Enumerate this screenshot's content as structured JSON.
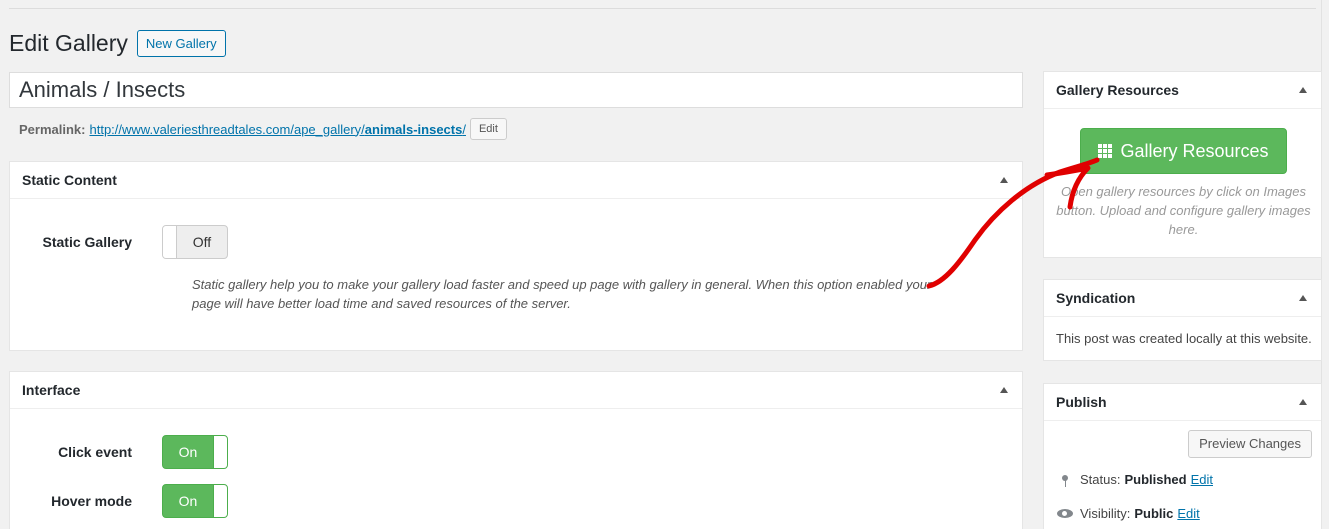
{
  "header": {
    "title": "Edit Gallery",
    "new_button": "New Gallery"
  },
  "post": {
    "title": "Animals / Insects",
    "permalink_label": "Permalink:",
    "permalink_base": "http://www.valeriesthreadtales.com/ape_gallery/",
    "permalink_slug": "animals-insects",
    "permalink_tail": "/",
    "permalink_edit": "Edit"
  },
  "static_content": {
    "heading": "Static Content",
    "option_label": "Static Gallery",
    "switch_value": "Off",
    "description": "Static gallery help you to make your gallery load faster and speed up page with gallery in general. When this option enabled your page will have better load time and saved resources of the server."
  },
  "interface": {
    "heading": "Interface",
    "options": [
      {
        "label": "Click event",
        "value": "On"
      },
      {
        "label": "Hover mode",
        "value": "On"
      }
    ]
  },
  "gallery_resources": {
    "heading": "Gallery Resources",
    "button": "Gallery Resources",
    "description": "Open gallery resources by click on Images button. Upload and configure gallery images here."
  },
  "syndication": {
    "heading": "Syndication",
    "text": "This post was created locally at this website."
  },
  "publish": {
    "heading": "Publish",
    "preview_button": "Preview Changes",
    "status_label": "Status:",
    "status_value": "Published",
    "visibility_label": "Visibility:",
    "visibility_value": "Public",
    "edit_link": "Edit"
  },
  "colors": {
    "accent": "#0073aa",
    "switch_on": "#5cb85c",
    "annotation_arrow": "#e00000"
  },
  "icons": [
    "toggle-arrow-icon",
    "grid-icon",
    "pin-icon",
    "eye-icon"
  ]
}
